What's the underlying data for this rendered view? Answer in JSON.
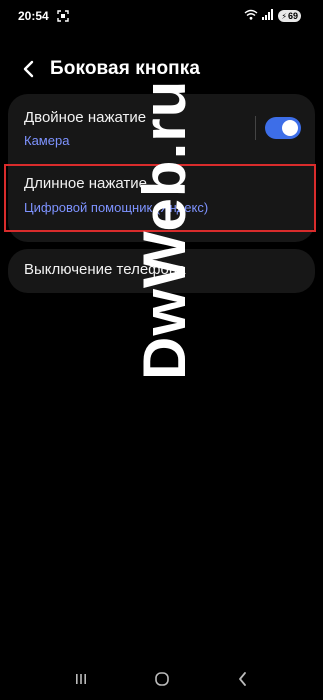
{
  "status_bar": {
    "time": "20:54",
    "battery": "69"
  },
  "header": {
    "title": "Боковая кнопка"
  },
  "settings": {
    "double_press": {
      "title": "Двойное нажатие",
      "value": "Камера",
      "toggle_on": true
    },
    "long_press": {
      "title": "Длинное нажатие",
      "value": "Цифровой помощник (Яндекс)"
    },
    "power_off": {
      "title": "Выключение телефона"
    }
  },
  "watermark": {
    "text": "DwWeb.ru"
  },
  "colors": {
    "accent": "#7e93ff",
    "toggle": "#3d6ee8",
    "highlight": "#d92c2c",
    "card_bg": "#171717"
  },
  "icons": {
    "back": "back-arrow-icon",
    "recents": "recents-icon",
    "home": "home-icon",
    "nav_back": "nav-back-icon"
  }
}
